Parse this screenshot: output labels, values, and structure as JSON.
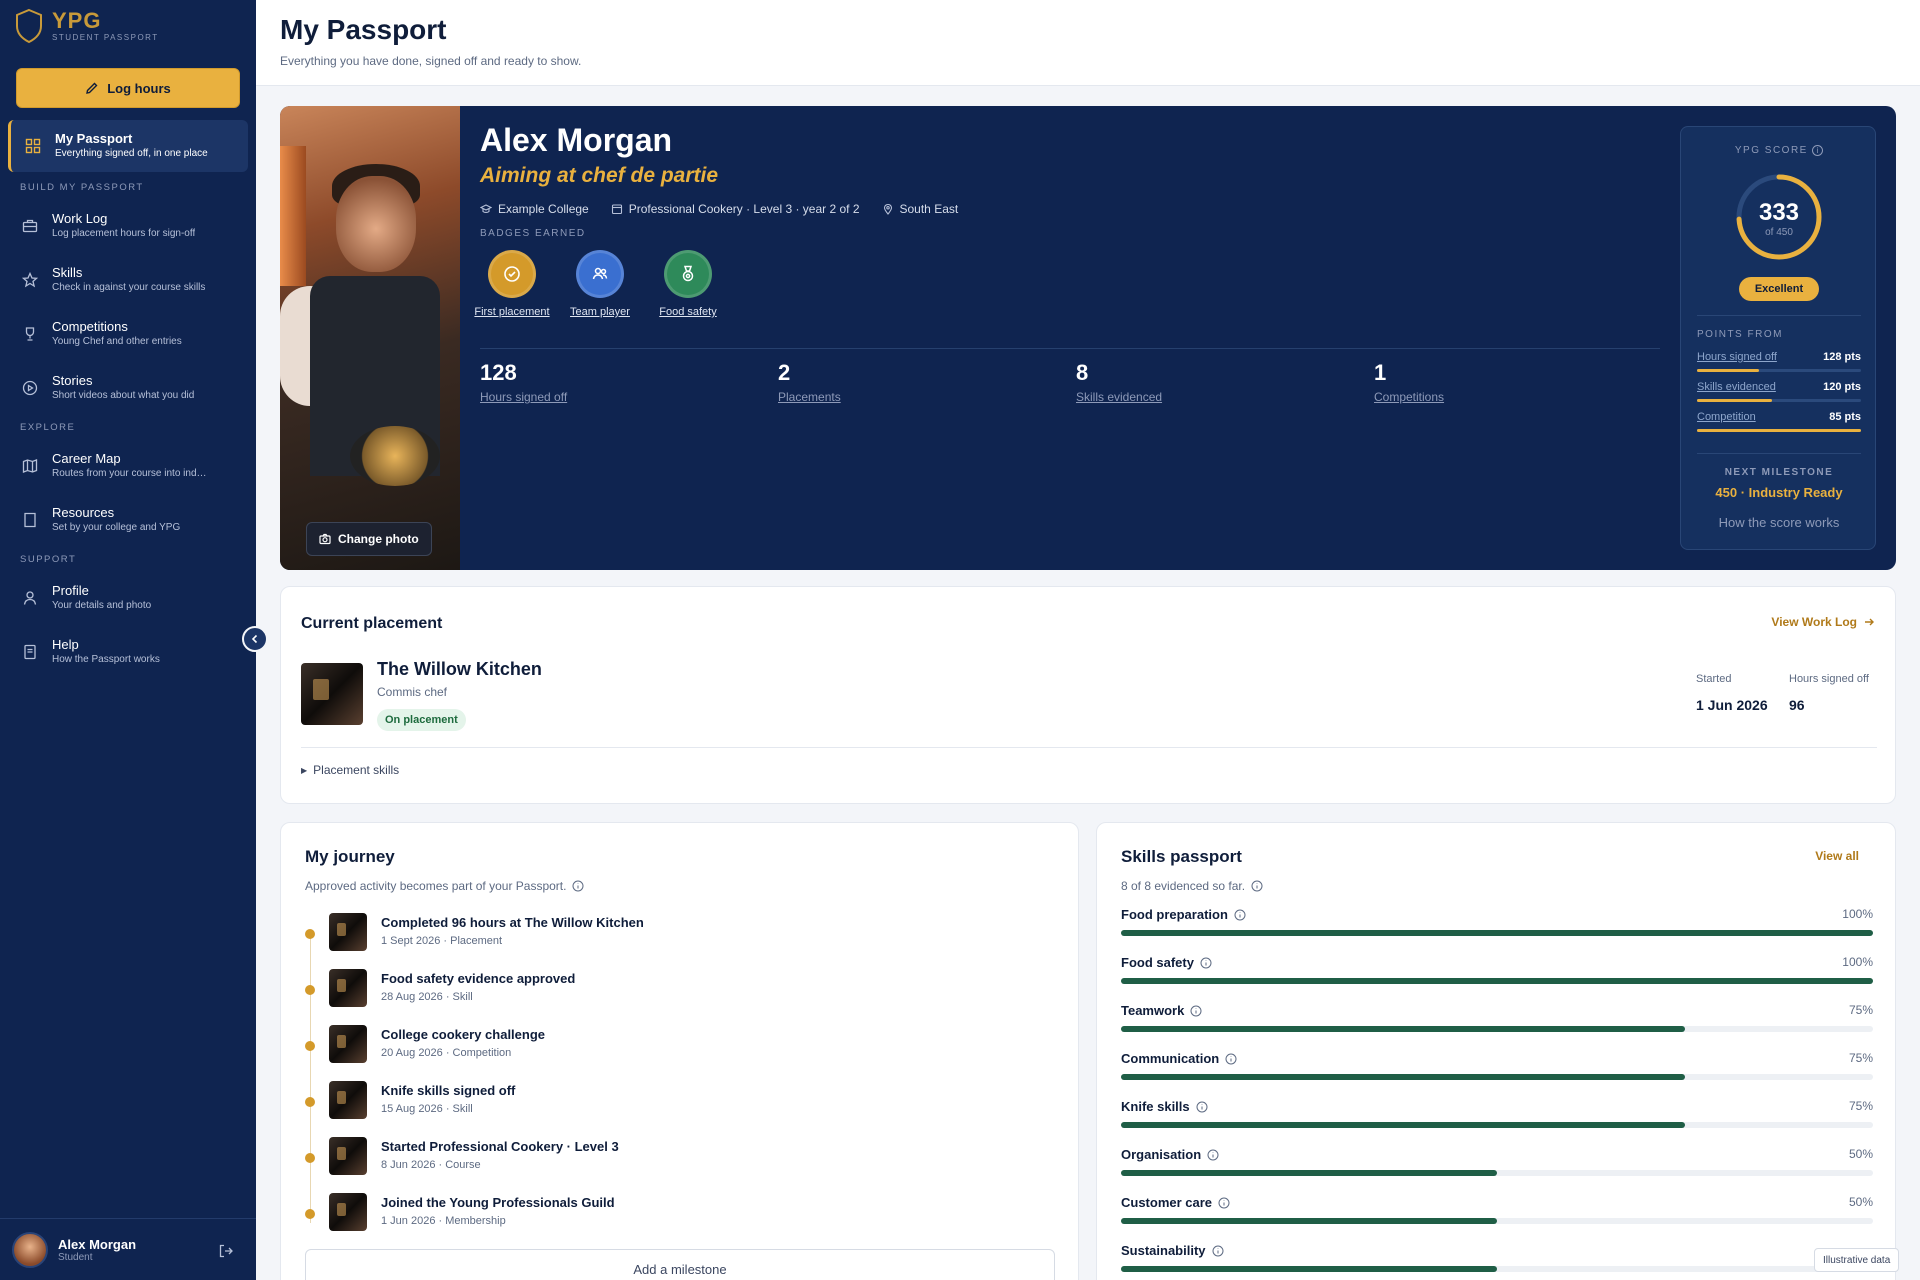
{
  "brand": {
    "name": "YPG",
    "tagline": "STUDENT PASSPORT"
  },
  "sidebar": {
    "log_hours": "Log hours",
    "active": {
      "title": "My Passport",
      "subtitle": "Everything signed off, in one place"
    },
    "sections": {
      "build": "BUILD MY PASSPORT",
      "explore": "EXPLORE",
      "support": "SUPPORT"
    },
    "items": [
      {
        "title": "Work Log",
        "subtitle": "Log placement hours for sign-off",
        "icon": "briefcase-icon"
      },
      {
        "title": "Skills",
        "subtitle": "Check in against your course skills",
        "icon": "star-icon"
      },
      {
        "title": "Competitions",
        "subtitle": "Young Chef and other entries",
        "icon": "trophy-icon"
      },
      {
        "title": "Stories",
        "subtitle": "Short videos about what you did",
        "icon": "play-icon"
      },
      {
        "title": "Career Map",
        "subtitle": "Routes from your course into ind…",
        "icon": "map-icon"
      },
      {
        "title": "Resources",
        "subtitle": "Set by your college and YPG",
        "icon": "book-icon"
      },
      {
        "title": "Profile",
        "subtitle": "Your details and photo",
        "icon": "user-icon"
      },
      {
        "title": "Help",
        "subtitle": "How the Passport works",
        "icon": "help-icon"
      }
    ],
    "user": {
      "name": "Alex Morgan",
      "role": "Student"
    }
  },
  "header": {
    "title": "My Passport",
    "subtitle": "Everything you have done, signed off and ready to show."
  },
  "hero": {
    "name": "Alex Morgan",
    "aim": "Aiming at chef de partie",
    "college": "Example College",
    "course": "Professional Cookery · Level 3 · year 2 of 2",
    "region": "South East",
    "badges_label": "BADGES EARNED",
    "badges": [
      {
        "label": "First placement",
        "color": "#d49a2a"
      },
      {
        "label": "Team player",
        "color": "#3a6fd0"
      },
      {
        "label": "Food safety",
        "color": "#2e8a5a"
      }
    ],
    "change_photo": "Change photo",
    "stats": [
      {
        "value": "128",
        "label": "Hours signed off"
      },
      {
        "value": "2",
        "label": "Placements"
      },
      {
        "value": "8",
        "label": "Skills evidenced"
      },
      {
        "value": "1",
        "label": "Competitions"
      }
    ]
  },
  "score": {
    "title": "YPG SCORE",
    "value": "333",
    "of": "of 450",
    "score": 333,
    "max": 450,
    "rating": "Excellent",
    "points_label": "POINTS FROM",
    "points": [
      {
        "label": "Hours signed off",
        "value": "128 pts",
        "fraction": 0.38
      },
      {
        "label": "Skills evidenced",
        "value": "120 pts",
        "fraction": 0.46
      },
      {
        "label": "Competition",
        "value": "85 pts",
        "fraction": 1.0
      }
    ],
    "milestone_label": "NEXT MILESTONE",
    "milestone": "450 · Industry Ready",
    "how": "How the score works"
  },
  "placement": {
    "title": "Current placement",
    "view": "View Work Log",
    "name": "The Willow Kitchen",
    "role": "Commis chef",
    "status": "On placement",
    "started_label": "Started",
    "started": "1 Jun 2026",
    "hours_label": "Hours signed off",
    "hours": "96",
    "skills_toggle": "Placement skills"
  },
  "journey": {
    "title": "My journey",
    "subtitle": "Approved activity becomes part of your Passport.",
    "items": [
      {
        "title": "Completed 96 hours at The Willow Kitchen",
        "meta": "1 Sept 2026 · Placement"
      },
      {
        "title": "Food safety evidence approved",
        "meta": "28 Aug 2026 · Skill"
      },
      {
        "title": "College cookery challenge",
        "meta": "20 Aug 2026 · Competition"
      },
      {
        "title": "Knife skills signed off",
        "meta": "15 Aug 2026 · Skill"
      },
      {
        "title": "Started Professional Cookery · Level 3",
        "meta": "8 Jun 2026 · Course"
      },
      {
        "title": "Joined the Young Professionals Guild",
        "meta": "1 Jun 2026 · Membership"
      }
    ],
    "add": "Add a milestone"
  },
  "skills": {
    "title": "Skills passport",
    "view_all": "View all",
    "subtitle": "8 of 8 evidenced so far.",
    "items": [
      {
        "name": "Food preparation",
        "pct": "100%",
        "value": 100
      },
      {
        "name": "Food safety",
        "pct": "100%",
        "value": 100
      },
      {
        "name": "Teamwork",
        "pct": "75%",
        "value": 75
      },
      {
        "name": "Communication",
        "pct": "75%",
        "value": 75
      },
      {
        "name": "Knife skills",
        "pct": "75%",
        "value": 75
      },
      {
        "name": "Organisation",
        "pct": "50%",
        "value": 50
      },
      {
        "name": "Customer care",
        "pct": "50%",
        "value": 50
      },
      {
        "name": "Sustainability",
        "pct": "",
        "value": 50
      }
    ]
  },
  "footer_note": "Illustrative data"
}
